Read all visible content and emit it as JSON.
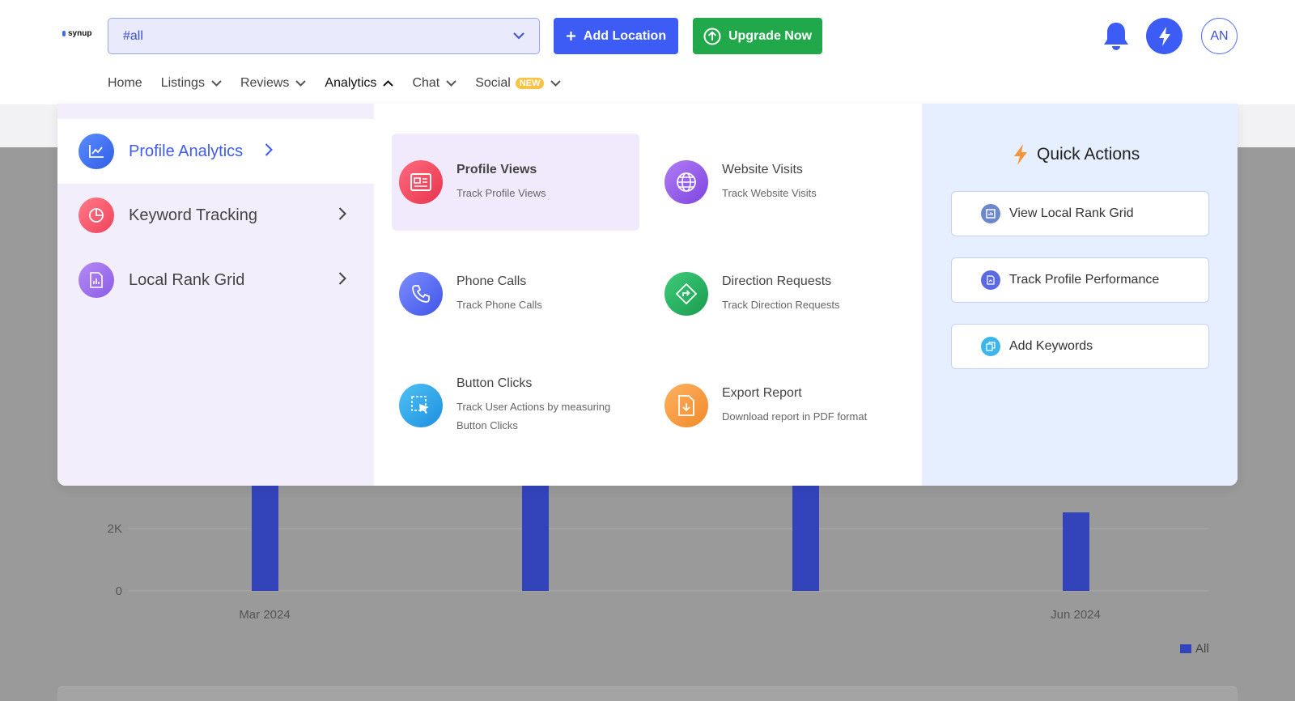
{
  "brand": {
    "logo_text": "synup"
  },
  "header": {
    "location_select": {
      "value": "#all",
      "icon": "chevron-down-icon"
    },
    "add_location_label": "Add Location",
    "upgrade_label": "Upgrade Now",
    "avatar_initials": "AN"
  },
  "nav": {
    "home": "Home",
    "listings": "Listings",
    "reviews": "Reviews",
    "analytics": "Analytics",
    "chat": "Chat",
    "social": "Social",
    "social_badge": "NEW"
  },
  "menu": {
    "left": [
      {
        "label": "Profile Analytics",
        "icon": "chart-line-icon",
        "active": true
      },
      {
        "label": "Keyword Tracking",
        "icon": "pie-chart-icon",
        "active": false
      },
      {
        "label": "Local Rank Grid",
        "icon": "bar-report-icon",
        "active": false
      }
    ],
    "tiles": [
      {
        "title": "Profile Views",
        "desc": "Track Profile Views",
        "icon": "profile-card-icon"
      },
      {
        "title": "Website Visits",
        "desc": "Track Website Visits",
        "icon": "globe-icon"
      },
      {
        "title": "Phone Calls",
        "desc": "Track Phone Calls",
        "icon": "phone-icon"
      },
      {
        "title": "Direction Requests",
        "desc": "Track Direction Requests",
        "icon": "direction-sign-icon"
      },
      {
        "title": "Button Clicks",
        "desc_line1": "Track User Actions by measuring",
        "desc_line2": "Button Clicks",
        "icon": "cursor-click-icon"
      },
      {
        "title": "Export Report",
        "desc": "Download report in PDF format",
        "icon": "file-download-icon"
      }
    ],
    "quick_actions": {
      "title": "Quick Actions",
      "items": [
        {
          "label": "View Local Rank Grid",
          "icon": "grid-icon"
        },
        {
          "label": "Track Profile Performance",
          "icon": "report-icon"
        },
        {
          "label": "Add Keywords",
          "icon": "copy-icon"
        }
      ]
    }
  },
  "chart_data": {
    "type": "bar",
    "y_ticks": [
      "0",
      "2K"
    ],
    "x_ticks": [
      "Mar 2024",
      "Jun 2024"
    ],
    "series": [
      {
        "name": "All",
        "values": [
          null,
          null,
          null,
          1900
        ]
      }
    ],
    "legend": "bottom-right",
    "color": "#3344bb"
  }
}
